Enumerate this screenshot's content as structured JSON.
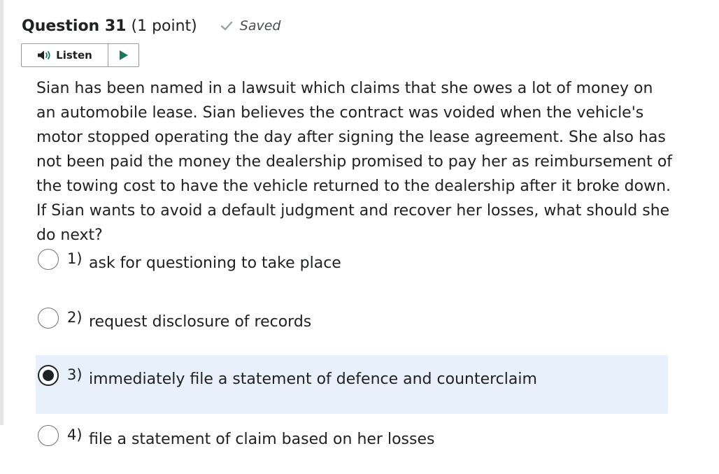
{
  "question": {
    "title": "Question 31",
    "points": "(1 point)",
    "saved_status": "Saved",
    "listen_label": "Listen",
    "text": "Sian has been named in a lawsuit which claims that she owes a lot of money on an automobile lease. Sian believes the contract was voided when the vehicle's motor stopped operating the day after signing the lease agreement. She also has not been paid the money the dealership promised to pay her as reimbursement of the towing cost to have the vehicle returned to the dealership after it broke down. If Sian wants to avoid a default judgment and recover her losses, what should she do next?"
  },
  "options": [
    {
      "number": "1)",
      "text": "ask for questioning to take place",
      "selected": false
    },
    {
      "number": "2)",
      "text": "request disclosure of records",
      "selected": false
    },
    {
      "number": "3)",
      "text": "immediately file a statement of defence and counterclaim",
      "selected": true
    },
    {
      "number": "4)",
      "text": "file a statement of claim based on her losses",
      "selected": false
    }
  ],
  "colors": {
    "selected_background": "#e8f1fb",
    "text": "#202122",
    "play_icon": "#1a7a52"
  },
  "icons": {
    "saved": "checkmark-icon",
    "listen": "speaker-icon",
    "play": "play-icon"
  }
}
